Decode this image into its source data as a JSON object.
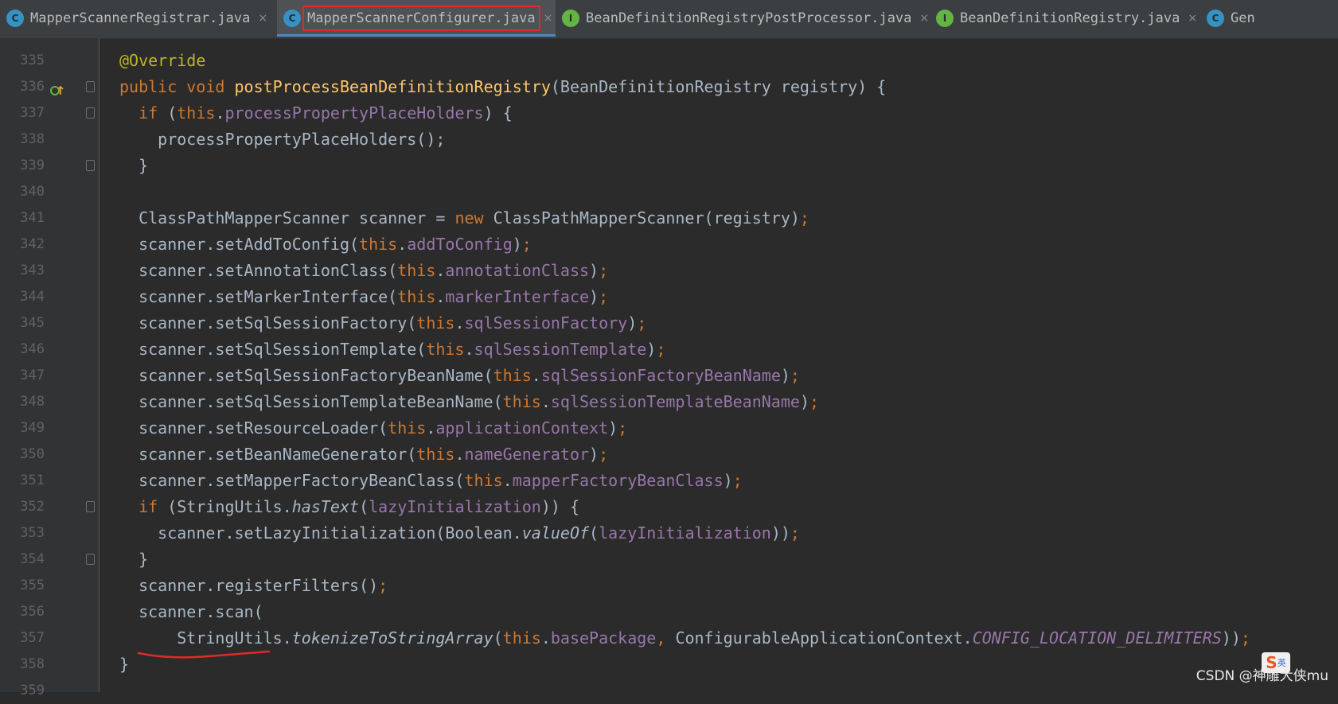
{
  "tabs": [
    {
      "label": "MapperScannerRegistrar.java",
      "icon": "class-icon",
      "icon_letter": "C",
      "active": false
    },
    {
      "label": "MapperScannerConfigurer.java",
      "icon": "class-icon",
      "icon_letter": "C",
      "active": true
    },
    {
      "label": "BeanDefinitionRegistryPostProcessor.java",
      "icon": "interface-icon",
      "icon_letter": "I",
      "active": false
    },
    {
      "label": "BeanDefinitionRegistry.java",
      "icon": "interface-icon",
      "icon_letter": "I",
      "active": false
    },
    {
      "label": "Gen",
      "icon": "class-icon",
      "icon_letter": "C",
      "active": false
    }
  ],
  "tab_close_glyph": "×",
  "editor": {
    "line_numbers": [
      "335",
      "336",
      "337",
      "338",
      "339",
      "340",
      "341",
      "342",
      "343",
      "344",
      "345",
      "346",
      "347",
      "348",
      "349",
      "350",
      "351",
      "352",
      "353",
      "354",
      "355",
      "356",
      "357",
      "358",
      "359"
    ],
    "code_lines": [
      [
        {
          "t": "ann",
          "v": "@Override"
        }
      ],
      [
        {
          "t": "kw",
          "v": "public void "
        },
        {
          "t": "fn",
          "v": "postProcessBeanDefinitionRegistry"
        },
        {
          "t": "pl",
          "v": "(BeanDefinitionRegistry registry) {"
        }
      ],
      [
        {
          "t": "pl",
          "v": "  "
        },
        {
          "t": "kw",
          "v": "if "
        },
        {
          "t": "pl",
          "v": "("
        },
        {
          "t": "kw",
          "v": "this"
        },
        {
          "t": "pl",
          "v": "."
        },
        {
          "t": "fld",
          "v": "processPropertyPlaceHolders"
        },
        {
          "t": "pl",
          "v": ") {"
        }
      ],
      [
        {
          "t": "pl",
          "v": "    processPropertyPlaceHolders();"
        }
      ],
      [
        {
          "t": "pl",
          "v": "  }"
        }
      ],
      [],
      [
        {
          "t": "pl",
          "v": "  ClassPathMapperScanner scanner = "
        },
        {
          "t": "kw",
          "v": "new "
        },
        {
          "t": "pl",
          "v": "ClassPathMapperScanner(registry)"
        },
        {
          "t": "kw",
          "v": ";"
        }
      ],
      [
        {
          "t": "pl",
          "v": "  scanner.setAddToConfig("
        },
        {
          "t": "kw",
          "v": "this"
        },
        {
          "t": "pl",
          "v": "."
        },
        {
          "t": "fld",
          "v": "addToConfig"
        },
        {
          "t": "pl",
          "v": ")"
        },
        {
          "t": "kw",
          "v": ";"
        }
      ],
      [
        {
          "t": "pl",
          "v": "  scanner.setAnnotationClass("
        },
        {
          "t": "kw",
          "v": "this"
        },
        {
          "t": "pl",
          "v": "."
        },
        {
          "t": "fld",
          "v": "annotationClass"
        },
        {
          "t": "pl",
          "v": ")"
        },
        {
          "t": "kw",
          "v": ";"
        }
      ],
      [
        {
          "t": "pl",
          "v": "  scanner.setMarkerInterface("
        },
        {
          "t": "kw",
          "v": "this"
        },
        {
          "t": "pl",
          "v": "."
        },
        {
          "t": "fld",
          "v": "markerInterface"
        },
        {
          "t": "pl",
          "v": ")"
        },
        {
          "t": "kw",
          "v": ";"
        }
      ],
      [
        {
          "t": "pl",
          "v": "  scanner.setSqlSessionFactory("
        },
        {
          "t": "kw",
          "v": "this"
        },
        {
          "t": "pl",
          "v": "."
        },
        {
          "t": "fld",
          "v": "sqlSessionFactory"
        },
        {
          "t": "pl",
          "v": ")"
        },
        {
          "t": "kw",
          "v": ";"
        }
      ],
      [
        {
          "t": "pl",
          "v": "  scanner.setSqlSessionTemplate("
        },
        {
          "t": "kw",
          "v": "this"
        },
        {
          "t": "pl",
          "v": "."
        },
        {
          "t": "fld",
          "v": "sqlSessionTemplate"
        },
        {
          "t": "pl",
          "v": ")"
        },
        {
          "t": "kw",
          "v": ";"
        }
      ],
      [
        {
          "t": "pl",
          "v": "  scanner.setSqlSessionFactoryBeanName("
        },
        {
          "t": "kw",
          "v": "this"
        },
        {
          "t": "pl",
          "v": "."
        },
        {
          "t": "fld",
          "v": "sqlSessionFactoryBeanName"
        },
        {
          "t": "pl",
          "v": ")"
        },
        {
          "t": "kw",
          "v": ";"
        }
      ],
      [
        {
          "t": "pl",
          "v": "  scanner.setSqlSessionTemplateBeanName("
        },
        {
          "t": "kw",
          "v": "this"
        },
        {
          "t": "pl",
          "v": "."
        },
        {
          "t": "fld",
          "v": "sqlSessionTemplateBeanName"
        },
        {
          "t": "pl",
          "v": ")"
        },
        {
          "t": "kw",
          "v": ";"
        }
      ],
      [
        {
          "t": "pl",
          "v": "  scanner.setResourceLoader("
        },
        {
          "t": "kw",
          "v": "this"
        },
        {
          "t": "pl",
          "v": "."
        },
        {
          "t": "fld",
          "v": "applicationContext"
        },
        {
          "t": "pl",
          "v": ")"
        },
        {
          "t": "kw",
          "v": ";"
        }
      ],
      [
        {
          "t": "pl",
          "v": "  scanner.setBeanNameGenerator("
        },
        {
          "t": "kw",
          "v": "this"
        },
        {
          "t": "pl",
          "v": "."
        },
        {
          "t": "fld",
          "v": "nameGenerator"
        },
        {
          "t": "pl",
          "v": ")"
        },
        {
          "t": "kw",
          "v": ";"
        }
      ],
      [
        {
          "t": "pl",
          "v": "  scanner.setMapperFactoryBeanClass("
        },
        {
          "t": "kw",
          "v": "this"
        },
        {
          "t": "pl",
          "v": "."
        },
        {
          "t": "fld",
          "v": "mapperFactoryBeanClass"
        },
        {
          "t": "pl",
          "v": ")"
        },
        {
          "t": "kw",
          "v": ";"
        }
      ],
      [
        {
          "t": "pl",
          "v": "  "
        },
        {
          "t": "kw",
          "v": "if "
        },
        {
          "t": "pl",
          "v": "(StringUtils."
        },
        {
          "t": "it",
          "v": "hasText"
        },
        {
          "t": "pl",
          "v": "("
        },
        {
          "t": "fld",
          "v": "lazyInitialization"
        },
        {
          "t": "pl",
          "v": ")) {"
        }
      ],
      [
        {
          "t": "pl",
          "v": "    scanner.setLazyInitialization(Boolean."
        },
        {
          "t": "it",
          "v": "valueOf"
        },
        {
          "t": "pl",
          "v": "("
        },
        {
          "t": "fld",
          "v": "lazyInitialization"
        },
        {
          "t": "pl",
          "v": "))"
        },
        {
          "t": "kw",
          "v": ";"
        }
      ],
      [
        {
          "t": "pl",
          "v": "  }"
        }
      ],
      [
        {
          "t": "pl",
          "v": "  scanner.registerFilters()"
        },
        {
          "t": "kw",
          "v": ";"
        }
      ],
      [
        {
          "t": "pl",
          "v": "  scanner.scan("
        }
      ],
      [
        {
          "t": "pl",
          "v": "      StringUtils."
        },
        {
          "t": "it",
          "v": "tokenizeToStringArray"
        },
        {
          "t": "pl",
          "v": "("
        },
        {
          "t": "kw",
          "v": "this"
        },
        {
          "t": "pl",
          "v": "."
        },
        {
          "t": "fld",
          "v": "basePackage"
        },
        {
          "t": "kw",
          "v": ", "
        },
        {
          "t": "pl",
          "v": "ConfigurableApplicationContext."
        },
        {
          "t": "st",
          "v": "CONFIG_LOCATION_DELIMITERS"
        },
        {
          "t": "pl",
          "v": "))"
        },
        {
          "t": "kw",
          "v": ";"
        }
      ],
      [
        {
          "t": "pl",
          "v": "}"
        }
      ],
      []
    ],
    "fold_lines": [
      336,
      337,
      339,
      352,
      354
    ],
    "override_marker_line": 336
  },
  "watermark": {
    "text": "CSDN @神雕大侠mu",
    "ime_logo_letter": "S",
    "ime_logo_badge": "英"
  },
  "colors": {
    "background": "#2b2b2b",
    "keyword": "#cc7832",
    "annotation": "#bbb529",
    "method": "#ffc66d",
    "field": "#9876aa",
    "text": "#a9b7c6",
    "highlight_box": "#e02a2a",
    "underline": "#e02a2a"
  }
}
